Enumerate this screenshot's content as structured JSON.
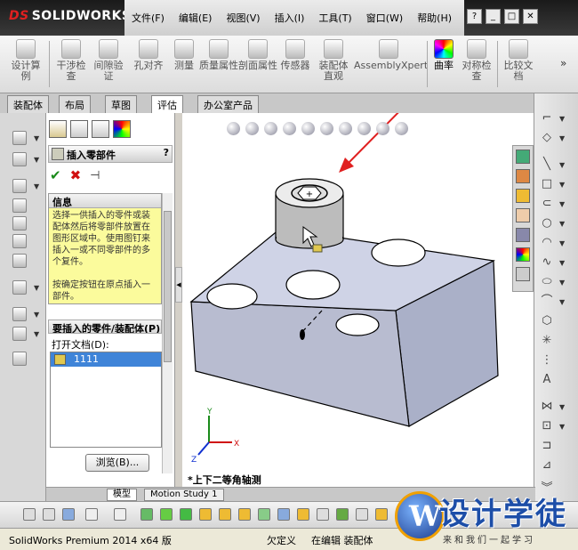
{
  "app": {
    "logo_brand": "SOLIDWORKS"
  },
  "menu": [
    "文件(F)",
    "编辑(E)",
    "视图(V)",
    "插入(I)",
    "工具(T)",
    "窗口(W)",
    "帮助(H)"
  ],
  "command_manager": [
    {
      "label": "设计算例",
      "icon": "study-icon"
    },
    {
      "label": "干涉检查",
      "icon": "interference-icon"
    },
    {
      "label": "间隙验证",
      "icon": "clearance-icon"
    },
    {
      "label": "孔对齐",
      "icon": "hole-align-icon"
    },
    {
      "label": "测量",
      "icon": "measure-icon"
    },
    {
      "label": "质量属性",
      "icon": "mass-props-icon"
    },
    {
      "label": "剖面属性",
      "icon": "section-props-icon"
    },
    {
      "label": "传感器",
      "icon": "sensor-icon"
    },
    {
      "label": "装配体直观",
      "icon": "assembly-visual-icon"
    },
    {
      "label": "AssemblyXpert",
      "icon": "assemblyxpert-icon"
    },
    {
      "label": "曲率",
      "icon": "curvature-icon"
    },
    {
      "label": "对称检查",
      "icon": "symmetry-icon"
    },
    {
      "label": "比较文档",
      "icon": "compare-icon"
    }
  ],
  "tabs": [
    "装配体",
    "布局",
    "草图",
    "评估",
    "办公室产品"
  ],
  "active_tab": "评估",
  "property_manager": {
    "title": "插入零部件",
    "help": "?",
    "info_title": "信息",
    "info_text": "选择一供插入的零件或装配体然后将零部件放置在图形区域中。使用图钉来插入一或不同零部件的多个复件。\n\n按确定按钮在原点插入一部件。",
    "parts_title": "要插入的零件/装配体(P)",
    "open_docs_label": "打开文档(D):",
    "open_docs": [
      "1111"
    ],
    "browse_button": "浏览(B)..."
  },
  "model_tabs": [
    "模型",
    "Motion Study 1"
  ],
  "view_label": "*上下二等角轴测",
  "status": {
    "product": "SolidWorks Premium 2014 x64 版",
    "definition": "欠定义",
    "mode": "在编辑 装配体"
  },
  "watermark": {
    "letter": "W",
    "title": "设计学徒",
    "subtitle": "来和我们一起学习"
  },
  "colors": {
    "accent": "#3f84d8",
    "info_bg": "#fbfb9c",
    "arrow": "#e02020",
    "model_face": "#cfd3e6"
  }
}
